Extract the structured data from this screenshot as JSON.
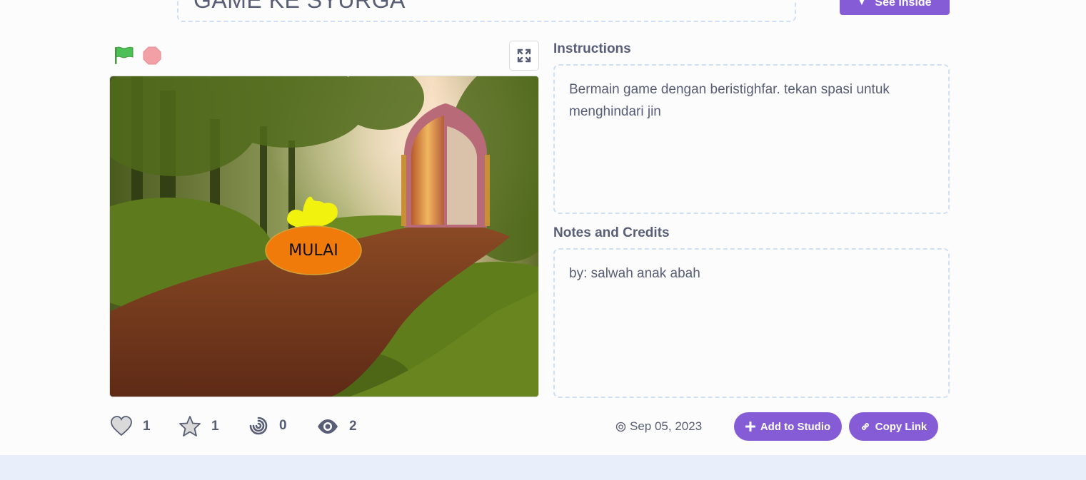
{
  "project": {
    "title": "GAME KE SYURGA",
    "see_inside_label": "See inside"
  },
  "stage": {
    "start_button_label": "MULAI"
  },
  "instructions": {
    "label": "Instructions",
    "text": "Bermain game dengan beristighfar. tekan spasi untuk menghindari jin"
  },
  "notes": {
    "label": "Notes and Credits",
    "text": "by: salwah anak abah"
  },
  "stats": {
    "loves": "1",
    "favorites": "1",
    "remixes": "0",
    "views": "2"
  },
  "share_date": "Sep 05, 2023",
  "actions": {
    "add_to_studio": "Add to Studio",
    "copy_link": "Copy Link"
  },
  "colors": {
    "accent": "#855cd6",
    "text": "#575e75",
    "flag": "#4cbf56",
    "stop": "#f2a0a6",
    "footer": "#e9effa"
  },
  "icons": [
    "green-flag-icon",
    "stop-icon",
    "fullscreen-icon",
    "heart-icon",
    "star-icon",
    "remix-icon",
    "eye-icon",
    "copyright-icon",
    "plus-icon",
    "link-icon"
  ]
}
